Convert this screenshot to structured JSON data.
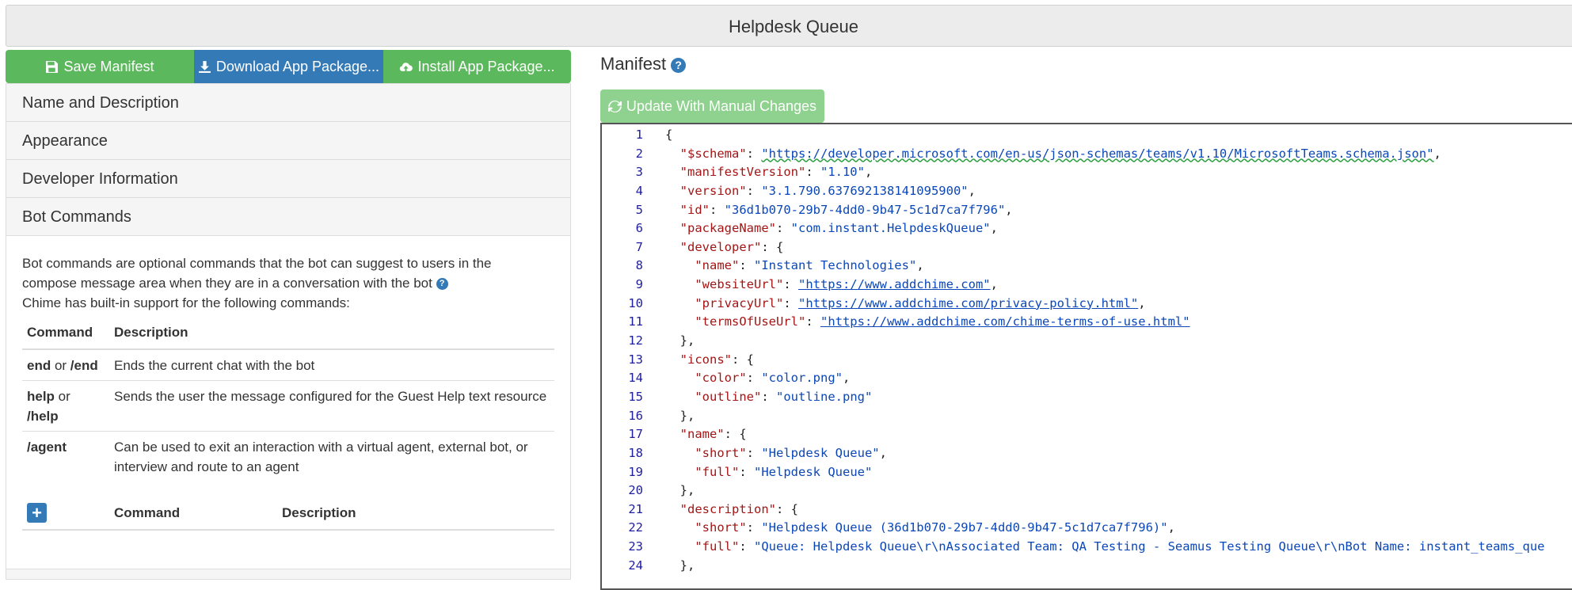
{
  "header": {
    "title": "Helpdesk Queue"
  },
  "toolbar": {
    "save_label": "Save Manifest",
    "download_label": "Download App Package...",
    "install_label": "Install App Package..."
  },
  "sections": {
    "name_description": "Name and Description",
    "appearance": "Appearance",
    "developer_info": "Developer Information",
    "bot_commands": "Bot Commands"
  },
  "bot_commands": {
    "intro_1": "Bot commands are optional commands that the bot can suggest to users in the",
    "intro_2": "compose message area when they are in a conversation with the bot",
    "intro_3": "Chime has built-in support for the following commands:",
    "col_command": "Command",
    "col_description": "Description",
    "rows": [
      {
        "cmd_a": "end",
        "or": " or ",
        "cmd_b": "/end",
        "desc": "Ends the current chat with the bot"
      },
      {
        "cmd_a": "help",
        "or": " or ",
        "cmd_b": "/help",
        "desc": "Sends the user the message configured for the Guest Help text resource"
      },
      {
        "cmd_a": "/agent",
        "or": "",
        "cmd_b": "",
        "desc": "Can be used to exit an interaction with a virtual agent, external bot, or interview and route to an agent"
      }
    ],
    "custom_col_command": "Command",
    "custom_col_description": "Description",
    "add_symbol": "+"
  },
  "manifest": {
    "title": "Manifest",
    "update_button": "Update With Manual Changes",
    "help_symbol": "?",
    "line_numbers": [
      "1",
      "2",
      "3",
      "4",
      "5",
      "6",
      "7",
      "8",
      "9",
      "10",
      "11",
      "12",
      "13",
      "14",
      "15",
      "16",
      "17",
      "18",
      "19",
      "20",
      "21",
      "22",
      "23",
      "24"
    ],
    "code": {
      "l1": "{",
      "l2k": "\"$schema\"",
      "l2v": "\"https://developer.microsoft.com/en-us/json-schemas/teams/v1.10/MicrosoftTeams.schema.json\"",
      "l3k": "\"manifestVersion\"",
      "l3v": "\"1.10\"",
      "l4k": "\"version\"",
      "l4v": "\"3.1.790.637692138141095900\"",
      "l5k": "\"id\"",
      "l5v": "\"36d1b070-29b7-4dd0-9b47-5c1d7ca7f796\"",
      "l6k": "\"packageName\"",
      "l6v": "\"com.instant.HelpdeskQueue\"",
      "l7k": "\"developer\"",
      "l8k": "\"name\"",
      "l8v": "\"Instant Technologies\"",
      "l9k": "\"websiteUrl\"",
      "l9v": "\"https://www.addchime.com\"",
      "l10k": "\"privacyUrl\"",
      "l10v": "\"https://www.addchime.com/privacy-policy.html\"",
      "l11k": "\"termsOfUseUrl\"",
      "l11v": "\"https://www.addchime.com/chime-terms-of-use.html\"",
      "l13k": "\"icons\"",
      "l14k": "\"color\"",
      "l14v": "\"color.png\"",
      "l15k": "\"outline\"",
      "l15v": "\"outline.png\"",
      "l17k": "\"name\"",
      "l18k": "\"short\"",
      "l18v": "\"Helpdesk Queue\"",
      "l19k": "\"full\"",
      "l19v": "\"Helpdesk Queue\"",
      "l21k": "\"description\"",
      "l22k": "\"short\"",
      "l22v": "\"Helpdesk Queue (36d1b070-29b7-4dd0-9b47-5c1d7ca7f796)\"",
      "l23k": "\"full\"",
      "l23v": "\"Queue: Helpdesk Queue\\r\\nAssociated Team: QA Testing - Seamus Testing Queue\\r\\nBot Name: instant_teams_que"
    }
  }
}
